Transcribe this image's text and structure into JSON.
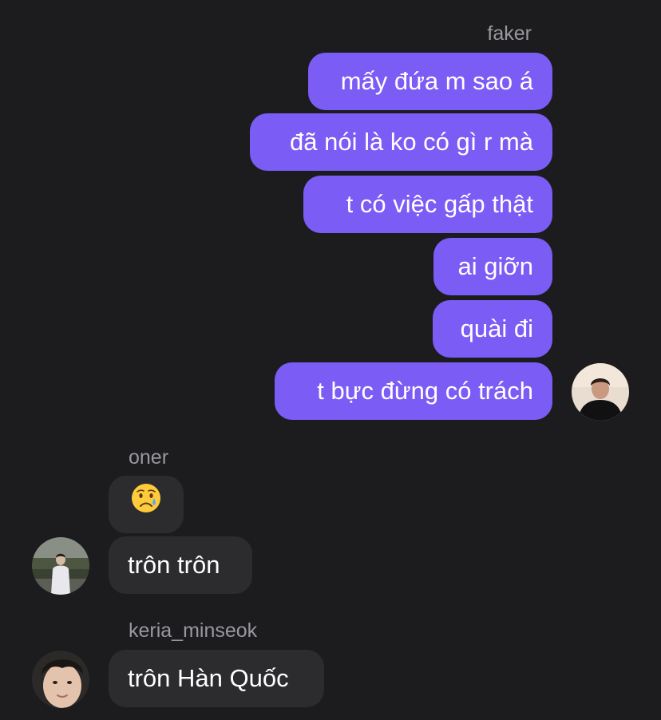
{
  "thread": {
    "groups": [
      {
        "sender": "faker",
        "direction": "outgoing",
        "messages": [
          "mấy đứa m sao á",
          "đã nói là ko có gì r mà",
          "t có việc gấp thật",
          "ai giỡn",
          "quài đi",
          "t bực đừng có trách"
        ]
      },
      {
        "sender": "oner",
        "direction": "incoming",
        "messages": [
          "😢",
          "trôn trôn"
        ]
      },
      {
        "sender": "keria_minseok",
        "direction": "incoming",
        "messages": [
          "trôn Hàn Quốc"
        ]
      }
    ]
  },
  "colors": {
    "background": "#1c1c1e",
    "outgoing_bubble": "#7b5cf5",
    "incoming_bubble": "#2c2c2e",
    "sender_name": "#98989f",
    "text": "#ffffff"
  }
}
